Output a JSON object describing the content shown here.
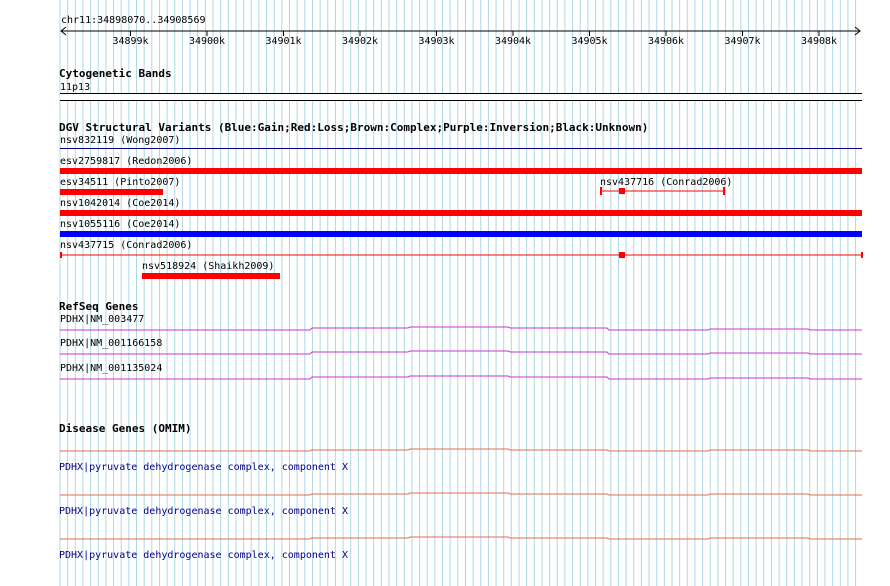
{
  "ruler": {
    "range": "chr11:34898070..34908569",
    "ticks": [
      "34899k",
      "34900k",
      "34901k",
      "34902k",
      "34903k",
      "34904k",
      "34905k",
      "34906k",
      "34907k",
      "34908k"
    ]
  },
  "tracks": {
    "cytobands": {
      "title": "Cytogenetic Bands",
      "band": "11p13"
    },
    "dgv": {
      "title": "DGV Structural Variants (Blue:Gain;Red:Loss;Brown:Complex;Purple:Inversion;Black:Unknown)",
      "features": [
        {
          "label": "nsv832119 (Wong2007)",
          "type": "Black:Unknown"
        },
        {
          "label": "esv2759817 (Redon2006)",
          "type": "Red:Loss"
        },
        {
          "label": "esv34511 (Pinto2007)",
          "type": "Red:Loss"
        },
        {
          "label": "nsv437716 (Conrad2006)",
          "type": "Red:Loss"
        },
        {
          "label": "nsv1042014 (Coe2014)",
          "type": "Red:Loss"
        },
        {
          "label": "nsv1055116 (Coe2014)",
          "type": "Blue:Gain"
        },
        {
          "label": "nsv437715 (Conrad2006)",
          "type": "Red:Loss"
        },
        {
          "label": "nsv518924 (Shaikh2009)",
          "type": "Red:Loss"
        }
      ]
    },
    "refseq": {
      "title": "RefSeq Genes",
      "genes": [
        "PDHX|NM_003477",
        "PDHX|NM_001166158",
        "PDHX|NM_001135024"
      ]
    },
    "omim": {
      "title": "Disease Genes (OMIM)",
      "genes": [
        "PDHX|pyruvate dehydrogenase complex, component X",
        "PDHX|pyruvate dehydrogenase complex, component X",
        "PDHX|pyruvate dehydrogenase complex, component X"
      ]
    }
  },
  "colors": {
    "grid": "#add8e6",
    "loss": "#ff0000",
    "gain": "#0000ff",
    "unknown": "#000000",
    "refseq": "#cc33cc",
    "omim": "#e36b4f",
    "link": "#00008b"
  }
}
